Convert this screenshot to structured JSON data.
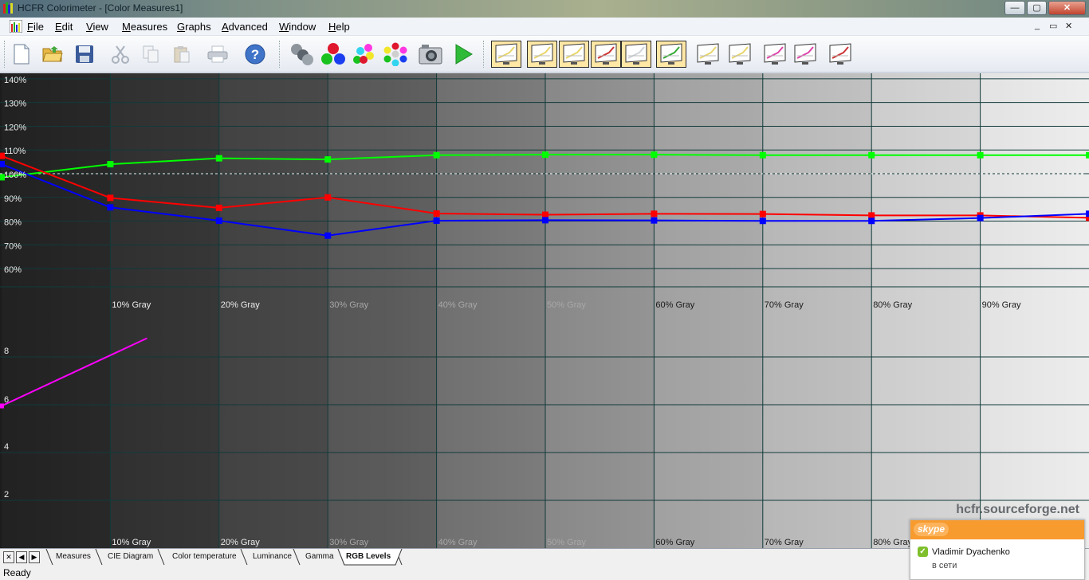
{
  "window": {
    "title": "HCFR Colorimeter - [Color Measures1]",
    "buttons": {
      "minimize": "—",
      "maximize": "▢",
      "close": "✕"
    }
  },
  "menu": {
    "items": [
      "File",
      "Edit",
      "View",
      "Measures",
      "Graphs",
      "Advanced",
      "Window",
      "Help"
    ],
    "mdi_buttons": {
      "minimize": "_",
      "restore": "▭",
      "close": "✕"
    }
  },
  "toolbar": {
    "buttons": [
      {
        "name": "new-document",
        "icon": "new-document-icon"
      },
      {
        "name": "open",
        "icon": "open-folder-icon"
      },
      {
        "name": "save",
        "icon": "floppy-disk-icon"
      },
      {
        "name": "cut",
        "icon": "scissors-icon"
      },
      {
        "name": "copy",
        "icon": "copy-icon"
      },
      {
        "name": "paste",
        "icon": "paste-icon"
      },
      {
        "name": "print",
        "icon": "printer-icon"
      },
      {
        "name": "help",
        "icon": "help-icon"
      },
      {
        "name": "sensor",
        "icon": "sensor-icon"
      },
      {
        "name": "primaries",
        "icon": "rgb-balls-icon"
      },
      {
        "name": "secondaries",
        "icon": "color-balls-icon"
      },
      {
        "name": "all-colors",
        "icon": "color-ring-icon"
      },
      {
        "name": "snapshot",
        "icon": "camera-icon"
      },
      {
        "name": "measure",
        "icon": "play-icon"
      }
    ],
    "graph_buttons": [
      {
        "name": "measures-view",
        "selected": true
      },
      {
        "name": "luminance-graph",
        "selected": true
      },
      {
        "name": "gamma-graph",
        "selected": true
      },
      {
        "name": "rgb-levels-graph",
        "selected": true
      },
      {
        "name": "color-temp-graph",
        "selected": true
      },
      {
        "name": "cie-diagram",
        "selected": true
      },
      {
        "name": "sat-luminance-graph",
        "selected": false
      },
      {
        "name": "sat-shift-graph",
        "selected": false
      },
      {
        "name": "sat-rgb-graph",
        "selected": false
      },
      {
        "name": "sat-colorimeter-graph",
        "selected": false
      },
      {
        "name": "near-black-graph",
        "selected": false
      }
    ]
  },
  "chart_data": [
    {
      "type": "line",
      "x": [
        "",
        "10% Gray",
        "20% Gray",
        "30% Gray",
        "40% Gray",
        "50% Gray",
        "60% Gray",
        "70% Gray",
        "80% Gray",
        "90% Gray",
        ""
      ],
      "y_ticks": [
        "140%",
        "130%",
        "120%",
        "110%",
        "100%",
        "90%",
        "80%",
        "70%",
        "60%"
      ],
      "ylim": [
        55,
        145
      ],
      "reference_line": 100,
      "series": [
        {
          "color": "#00ff00",
          "values": [
            98.5,
            104,
            106.5,
            106,
            107.8,
            108,
            108,
            107.8,
            107.8,
            107.8,
            107.8
          ]
        },
        {
          "color": "#ff0000",
          "values": [
            107.5,
            89.8,
            85.6,
            90,
            83.2,
            82.7,
            83.1,
            83,
            82.4,
            82.4,
            81.4
          ]
        },
        {
          "color": "#0000ff",
          "values": [
            104,
            85.8,
            80.2,
            73.9,
            80.2,
            80.4,
            80.3,
            80.1,
            80.1,
            81.3,
            83.1
          ]
        }
      ]
    },
    {
      "type": "line",
      "x": [
        "",
        "10% Gray",
        "20% Gray",
        "30% Gray",
        "40% Gray",
        "50% Gray",
        "60% Gray",
        "70% Gray",
        "80% Gray",
        "90% Gray"
      ],
      "y_ticks": [
        "8",
        "6",
        "4",
        "2"
      ],
      "ylim": [
        0,
        10
      ],
      "series": [
        {
          "color": "#ff00ff",
          "values": [
            6.5,
            9.9
          ]
        }
      ]
    }
  ],
  "watermark": "hcfr.sourceforge.net",
  "tabs": [
    "Measures",
    "CIE Diagram",
    "Color temperature",
    "Luminance",
    "Gamma",
    "RGB Levels"
  ],
  "active_tab": "RGB Levels",
  "tab_nav": [
    "✕",
    "◀",
    "▶"
  ],
  "status": "Ready",
  "skype": {
    "logo": "skype",
    "contact": "Vladimir Dyachenko",
    "status": "в сети"
  }
}
